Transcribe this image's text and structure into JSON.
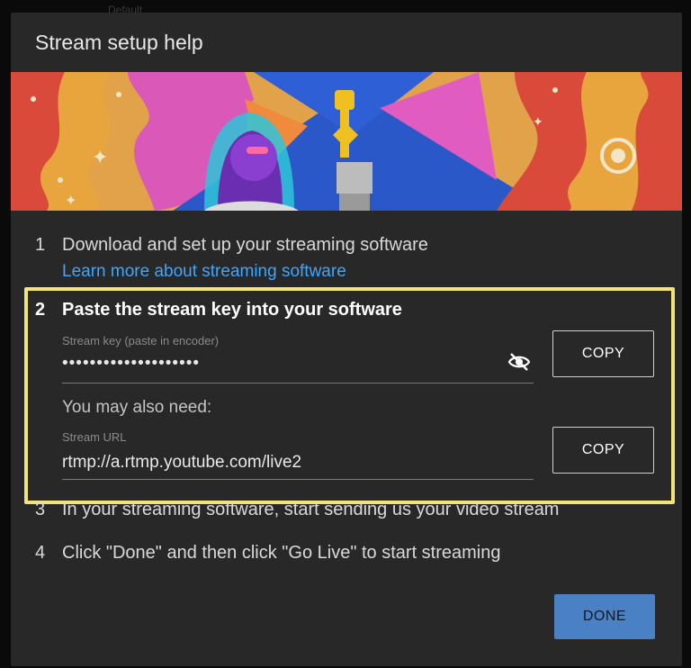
{
  "backdrop": {
    "text": "Default"
  },
  "dialog": {
    "title": "Stream setup help",
    "steps": [
      {
        "num": "1",
        "text": "Download and set up your streaming software"
      },
      {
        "num": "2",
        "text": "Paste the stream key into your software"
      },
      {
        "num": "3",
        "text": "In your streaming software, start sending us your video stream"
      },
      {
        "num": "4",
        "text": "Click \"Done\" and then click \"Go Live\" to start streaming"
      }
    ],
    "learn_more_link": "Learn more about streaming software",
    "stream_key": {
      "label": "Stream key (paste in encoder)",
      "value": "••••••••••••••••••••",
      "copy_label": "COPY"
    },
    "also_need": "You may also need:",
    "stream_url": {
      "label": "Stream URL",
      "value": "rtmp://a.rtmp.youtube.com/live2",
      "copy_label": "COPY"
    },
    "done_label": "DONE"
  },
  "colors": {
    "dialog_bg": "#282828",
    "link": "#3ea6ff",
    "highlight_border": "#f4e27a",
    "done_button": "#4a80c4"
  },
  "icons": {
    "visibility": "visibility-off-icon"
  }
}
